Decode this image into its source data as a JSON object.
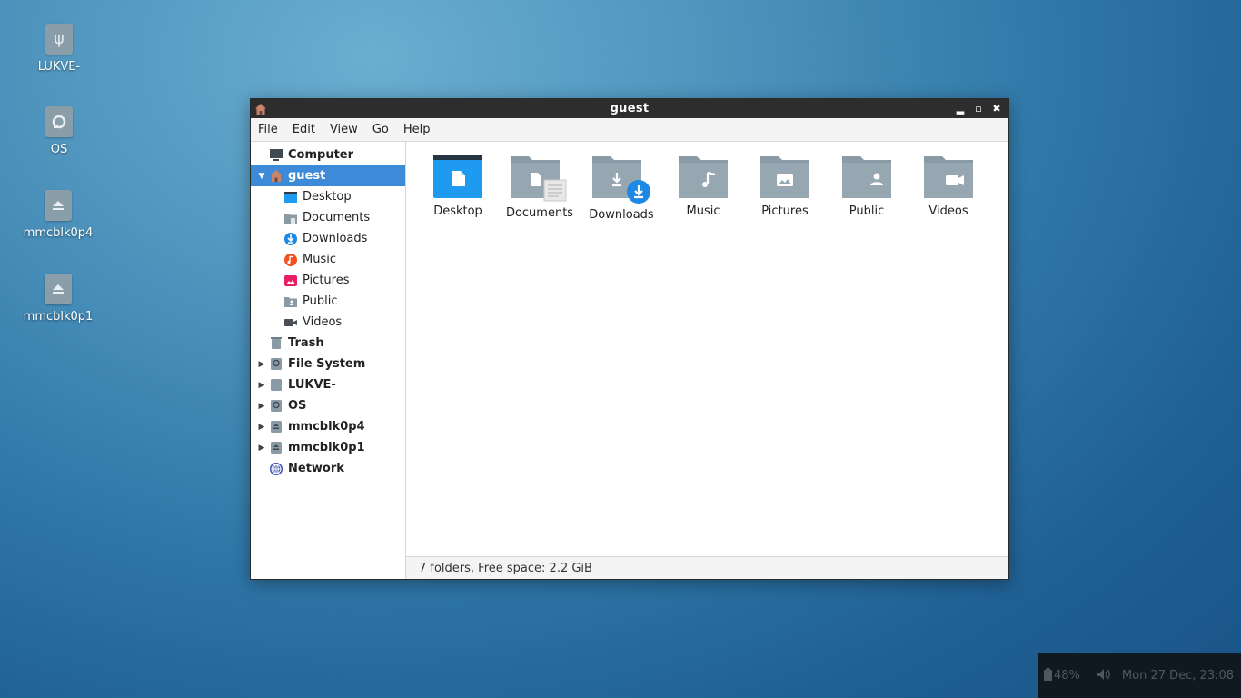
{
  "desktop": {
    "icons": [
      {
        "label": "LUKVE-",
        "icon": "usb-drive-icon"
      },
      {
        "label": "OS",
        "icon": "hard-disk-icon"
      },
      {
        "label": "mmcblk0p4",
        "icon": "eject-drive-icon"
      },
      {
        "label": "mmcblk0p1",
        "icon": "eject-drive-icon"
      }
    ]
  },
  "window": {
    "title": "guest",
    "controls": {
      "minimize": "minimize-icon",
      "maximize": "maximize-icon",
      "close": "close-icon"
    }
  },
  "menu": [
    "File",
    "Edit",
    "View",
    "Go",
    "Help"
  ],
  "sidebar": {
    "items": [
      {
        "label": "Computer",
        "icon": "computer-icon"
      },
      {
        "label": "guest",
        "icon": "home-icon",
        "selected": true,
        "expanded": true
      },
      {
        "label": "Desktop",
        "icon": "desktop-folder-icon"
      },
      {
        "label": "Documents",
        "icon": "documents-folder-icon"
      },
      {
        "label": "Downloads",
        "icon": "downloads-icon"
      },
      {
        "label": "Music",
        "icon": "music-icon"
      },
      {
        "label": "Pictures",
        "icon": "pictures-icon"
      },
      {
        "label": "Public",
        "icon": "public-folder-icon"
      },
      {
        "label": "Videos",
        "icon": "videos-icon"
      },
      {
        "label": "Trash",
        "icon": "trash-icon"
      },
      {
        "label": "File System",
        "icon": "hard-disk-icon"
      },
      {
        "label": "LUKVE-",
        "icon": "usb-drive-icon"
      },
      {
        "label": "OS",
        "icon": "hard-disk-icon"
      },
      {
        "label": "mmcblk0p4",
        "icon": "eject-drive-icon"
      },
      {
        "label": "mmcblk0p1",
        "icon": "eject-drive-icon"
      },
      {
        "label": "Network",
        "icon": "network-icon"
      }
    ]
  },
  "content": {
    "folders": [
      {
        "label": "Desktop",
        "icon": "desktop-folder-icon"
      },
      {
        "label": "Documents",
        "icon": "documents-folder-icon"
      },
      {
        "label": "Downloads",
        "icon": "downloads-folder-icon"
      },
      {
        "label": "Music",
        "icon": "music-folder-icon"
      },
      {
        "label": "Pictures",
        "icon": "pictures-folder-icon"
      },
      {
        "label": "Public",
        "icon": "public-folder-icon"
      },
      {
        "label": "Videos",
        "icon": "videos-folder-icon"
      }
    ]
  },
  "status": "7 folders, Free space: 2.2 GiB",
  "panel": {
    "battery": "48%",
    "clock": "Mon 27 Dec, 23:08"
  },
  "colors": {
    "selection": "#3c8ad8",
    "folder_gray": "#8b9ba6",
    "accent_blue": "#1e9bf0"
  }
}
